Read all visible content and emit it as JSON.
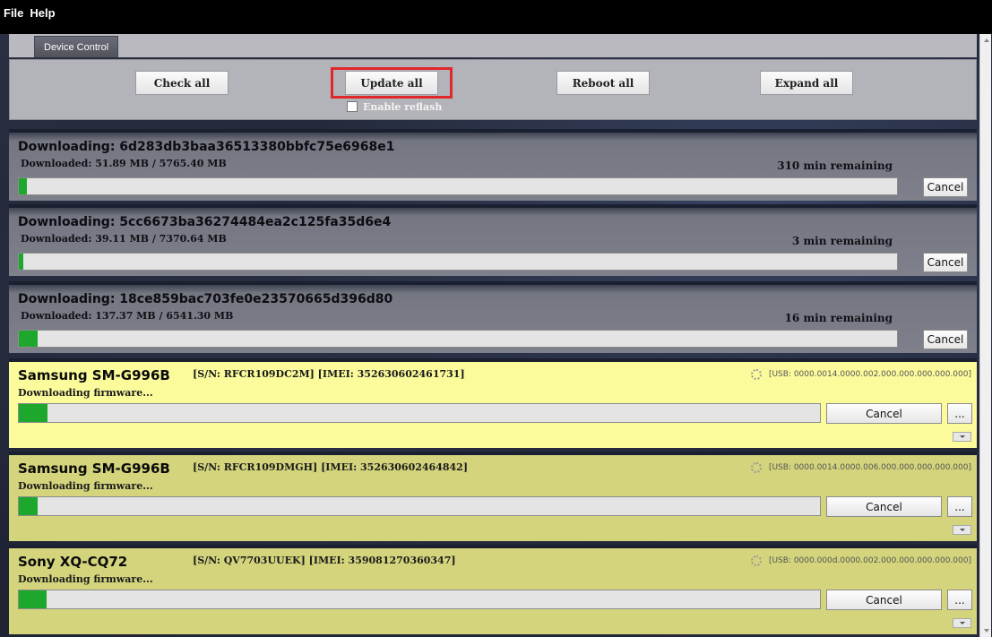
{
  "menu": {
    "items": [
      "File",
      "Help"
    ]
  },
  "tabs": [
    {
      "label": "Device Control"
    }
  ],
  "controls": {
    "check_all": "Check all",
    "update_all": "Update all",
    "reboot_all": "Reboot all",
    "expand_all": "Expand all",
    "enable_reflash": "Enable reflash",
    "enable_reflash_checked": false
  },
  "downloads": [
    {
      "title": "Downloading: 6d283db3baa36513380bbfc75e6968e1",
      "downloaded": "Downloaded: 51.89 MB / 5765.40 MB",
      "remaining": "310 min remaining",
      "progress": 0.009,
      "cancel_label": "Cancel"
    },
    {
      "title": "Downloading: 5cc6673ba36274484ea2c125fa35d6e4",
      "downloaded": "Downloaded: 39.11 MB / 7370.64 MB",
      "remaining": "3 min remaining",
      "progress": 0.005,
      "cancel_label": "Cancel"
    },
    {
      "title": "Downloading: 18ce859bac703fe0e23570665d396d80",
      "downloaded": "Downloaded: 137.37 MB / 6541.30 MB",
      "remaining": "16 min remaining",
      "progress": 0.021,
      "cancel_label": "Cancel"
    }
  ],
  "devices": [
    {
      "name": "Samsung SM-G996B",
      "ids": "[S/N: RFCR109DC2M] [IMEI: 352630602461731]",
      "usb": "[USB: 0000.0014.0000.002.000.000.000.000.000]",
      "status": "Downloading firmware...",
      "progress": 0.036,
      "cancel_label": "Cancel",
      "more_label": "...",
      "selected": true
    },
    {
      "name": "Samsung SM-G996B",
      "ids": "[S/N: RFCR109DMGH] [IMEI: 352630602464842]",
      "usb": "[USB: 0000.0014.0000.006.000.000.000.000.000]",
      "status": "Downloading firmware...",
      "progress": 0.024,
      "cancel_label": "Cancel",
      "more_label": "...",
      "selected": false
    },
    {
      "name": "Sony XQ-CQ72",
      "ids": "[S/N: QV7703UUEK] [IMEI: 359081270360347]",
      "usb": "[USB: 0000.000d.0000.002.000.000.000.000.000]",
      "status": "Downloading firmware...",
      "progress": 0.035,
      "cancel_label": "Cancel",
      "more_label": "...",
      "selected": false
    }
  ],
  "colors": {
    "progress": "#1da72c",
    "device_active": "#fbfb9c",
    "device_dim": "#d3d47c",
    "highlight": "#e0282a"
  }
}
